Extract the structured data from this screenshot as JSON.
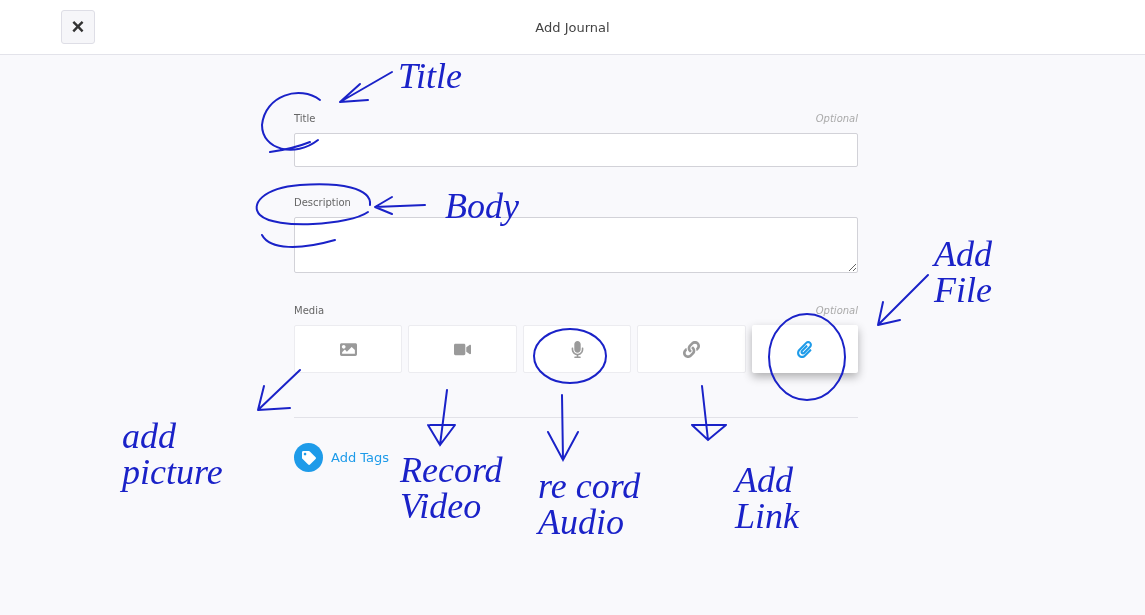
{
  "header": {
    "close": "×",
    "title": "Add Journal"
  },
  "fields": [
    {
      "kind": "input",
      "label": "Title",
      "hint": "Optional"
    },
    {
      "kind": "textarea",
      "label": "Description"
    }
  ],
  "media": {
    "label": "Media",
    "hint": "Optional",
    "buttons": [
      {
        "kind": "image",
        "selected": false
      },
      {
        "kind": "video",
        "selected": false
      },
      {
        "kind": "audio",
        "selected": false
      },
      {
        "kind": "link",
        "selected": false
      },
      {
        "kind": "file",
        "selected": true
      }
    ]
  },
  "tags": {
    "label": "Add Tags"
  },
  "annotations": [
    {
      "text": "Title"
    },
    {
      "text": "Body"
    },
    {
      "text": "Add File"
    },
    {
      "text": "add picture"
    },
    {
      "text": "Record Video"
    },
    {
      "text": "re cord Audio"
    },
    {
      "text": "Add Link"
    }
  ]
}
